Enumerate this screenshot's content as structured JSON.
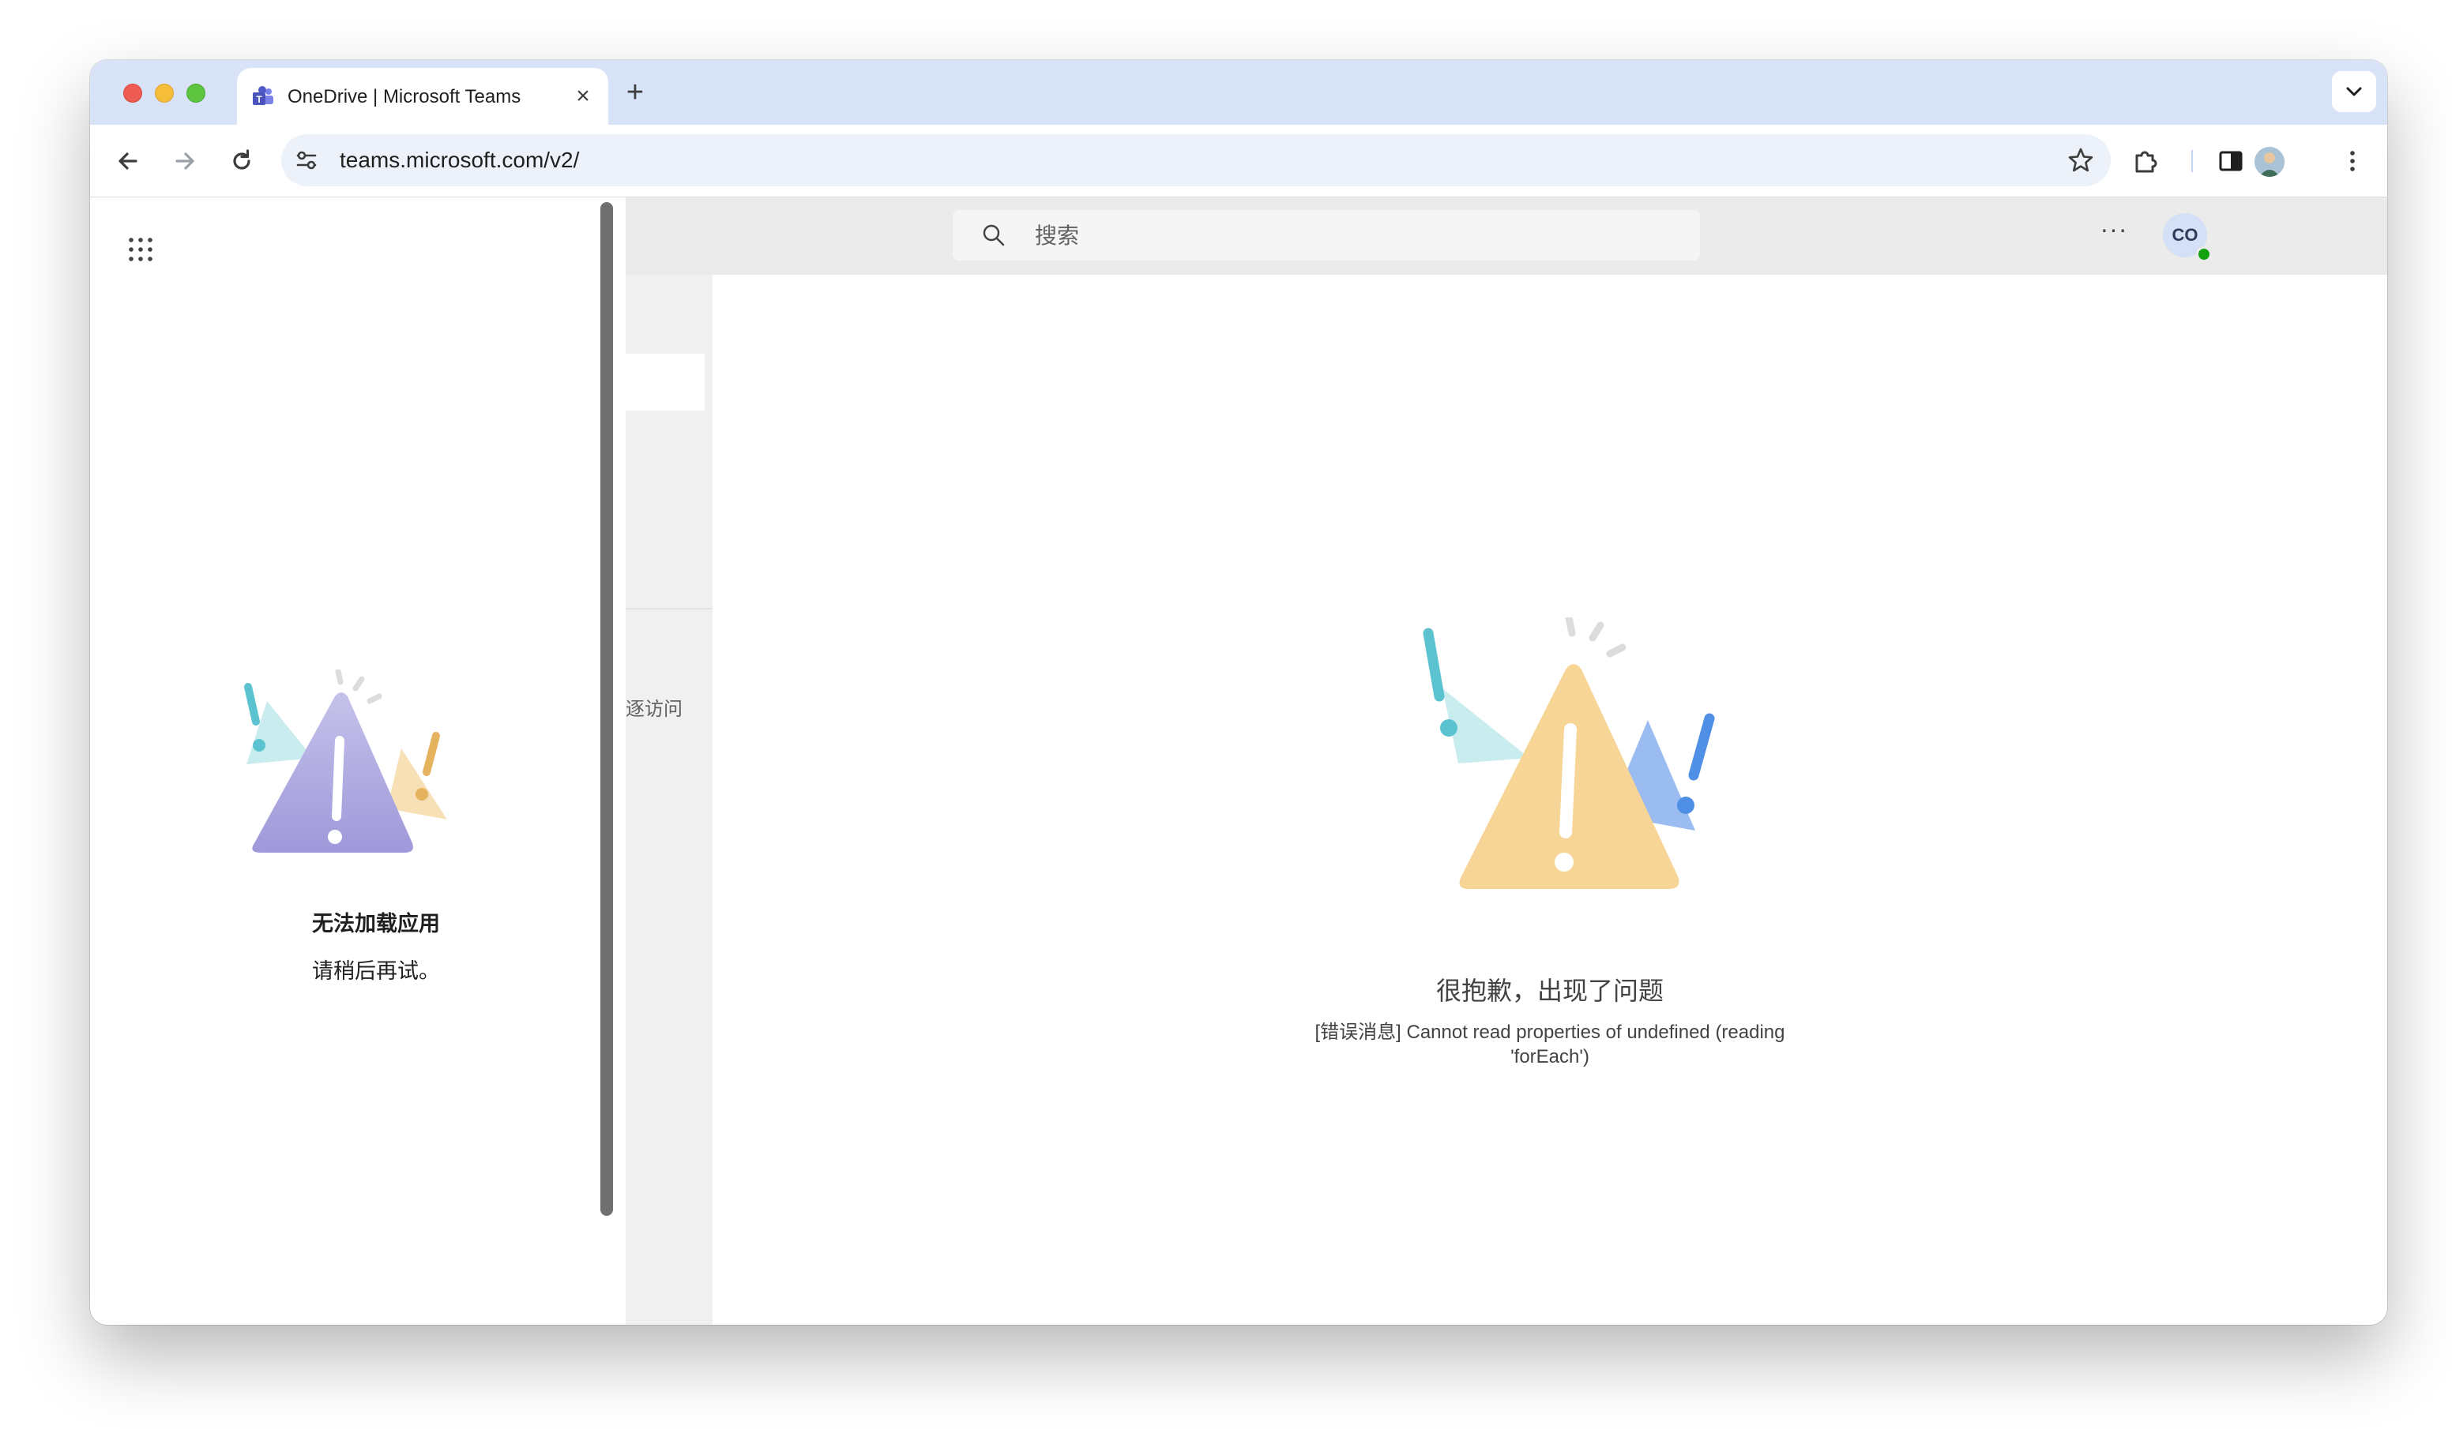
{
  "browser": {
    "tab_title": "OneDrive | Microsoft Teams",
    "tab_icon": "teams-icon",
    "url": "teams.microsoft.com/v2/"
  },
  "teams": {
    "search_placeholder": "搜索",
    "more_label": "···",
    "avatar_initials": "CO",
    "left_pane_text": "逐访问"
  },
  "flyout": {
    "title": "无法加载应用",
    "subtitle": "请稍后再试。"
  },
  "error": {
    "title": "很抱歉，出现了问题",
    "detail": "[错误消息] Cannot read properties of undefined (reading 'forEach')"
  },
  "colors": {
    "tab_strip": "#d9e3f7",
    "omnibox": "#edf1f9",
    "teams_header": "#ebebeb",
    "warning_main": "#f7d596",
    "warning_purple": "#a9a3dc",
    "accent_teal": "#5bc2cf",
    "accent_blue": "#4f8fe6"
  }
}
